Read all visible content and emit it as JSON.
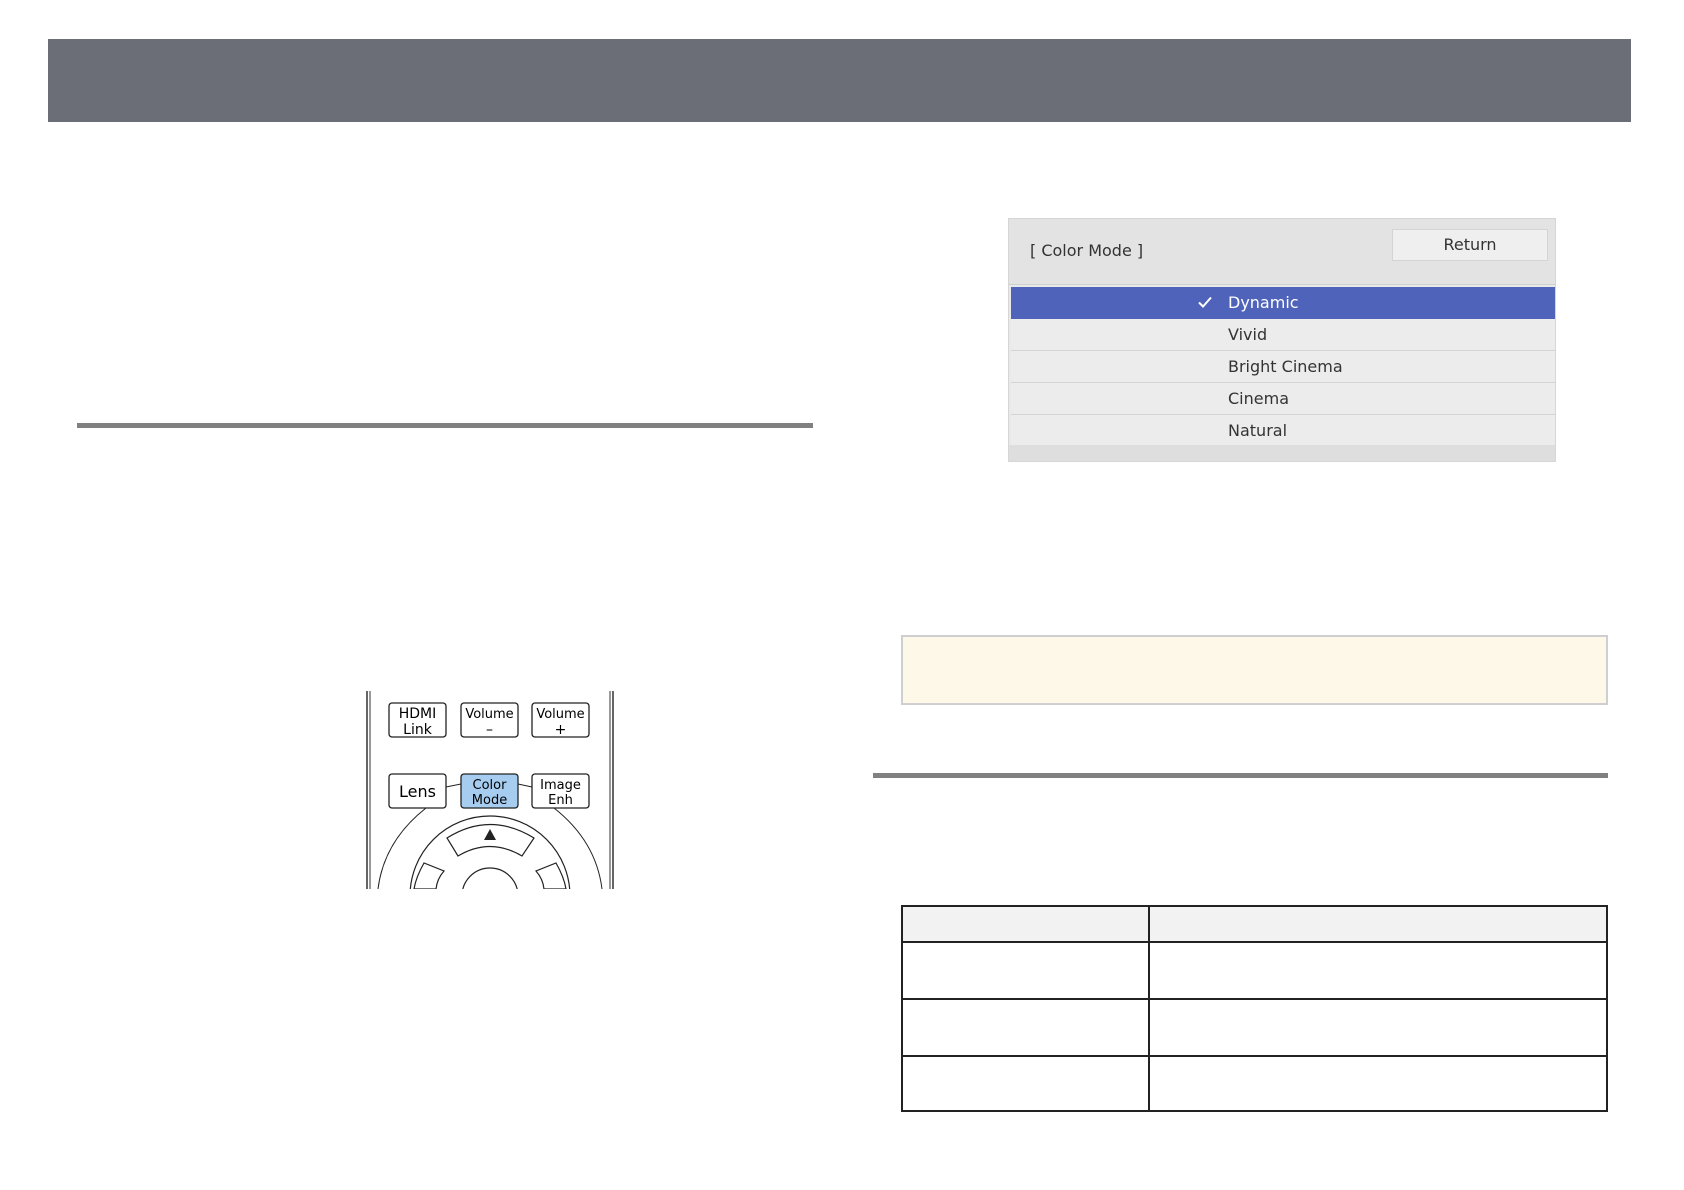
{
  "menu": {
    "title": "[ Color Mode ]",
    "return_label": "Return",
    "items": [
      {
        "label": "Dynamic",
        "selected": true
      },
      {
        "label": "Vivid",
        "selected": false
      },
      {
        "label": "Bright Cinema",
        "selected": false
      },
      {
        "label": "Cinema",
        "selected": false
      },
      {
        "label": "Natural",
        "selected": false
      }
    ],
    "selected_color": "#4e63b9"
  },
  "remote": {
    "buttons": {
      "hdmi_link": [
        "HDMI",
        "Link"
      ],
      "volume_minus": [
        "Volume",
        "–"
      ],
      "volume_plus": [
        "Volume",
        "+"
      ],
      "lens": "Lens",
      "color_mode": [
        "Color",
        "Mode"
      ],
      "image_enh": [
        "Image",
        "Enh"
      ]
    },
    "highlight_color": "#a6cdf0"
  },
  "colors": {
    "header_bar": "#6b6e76",
    "note_background": "#fdf8e8"
  }
}
